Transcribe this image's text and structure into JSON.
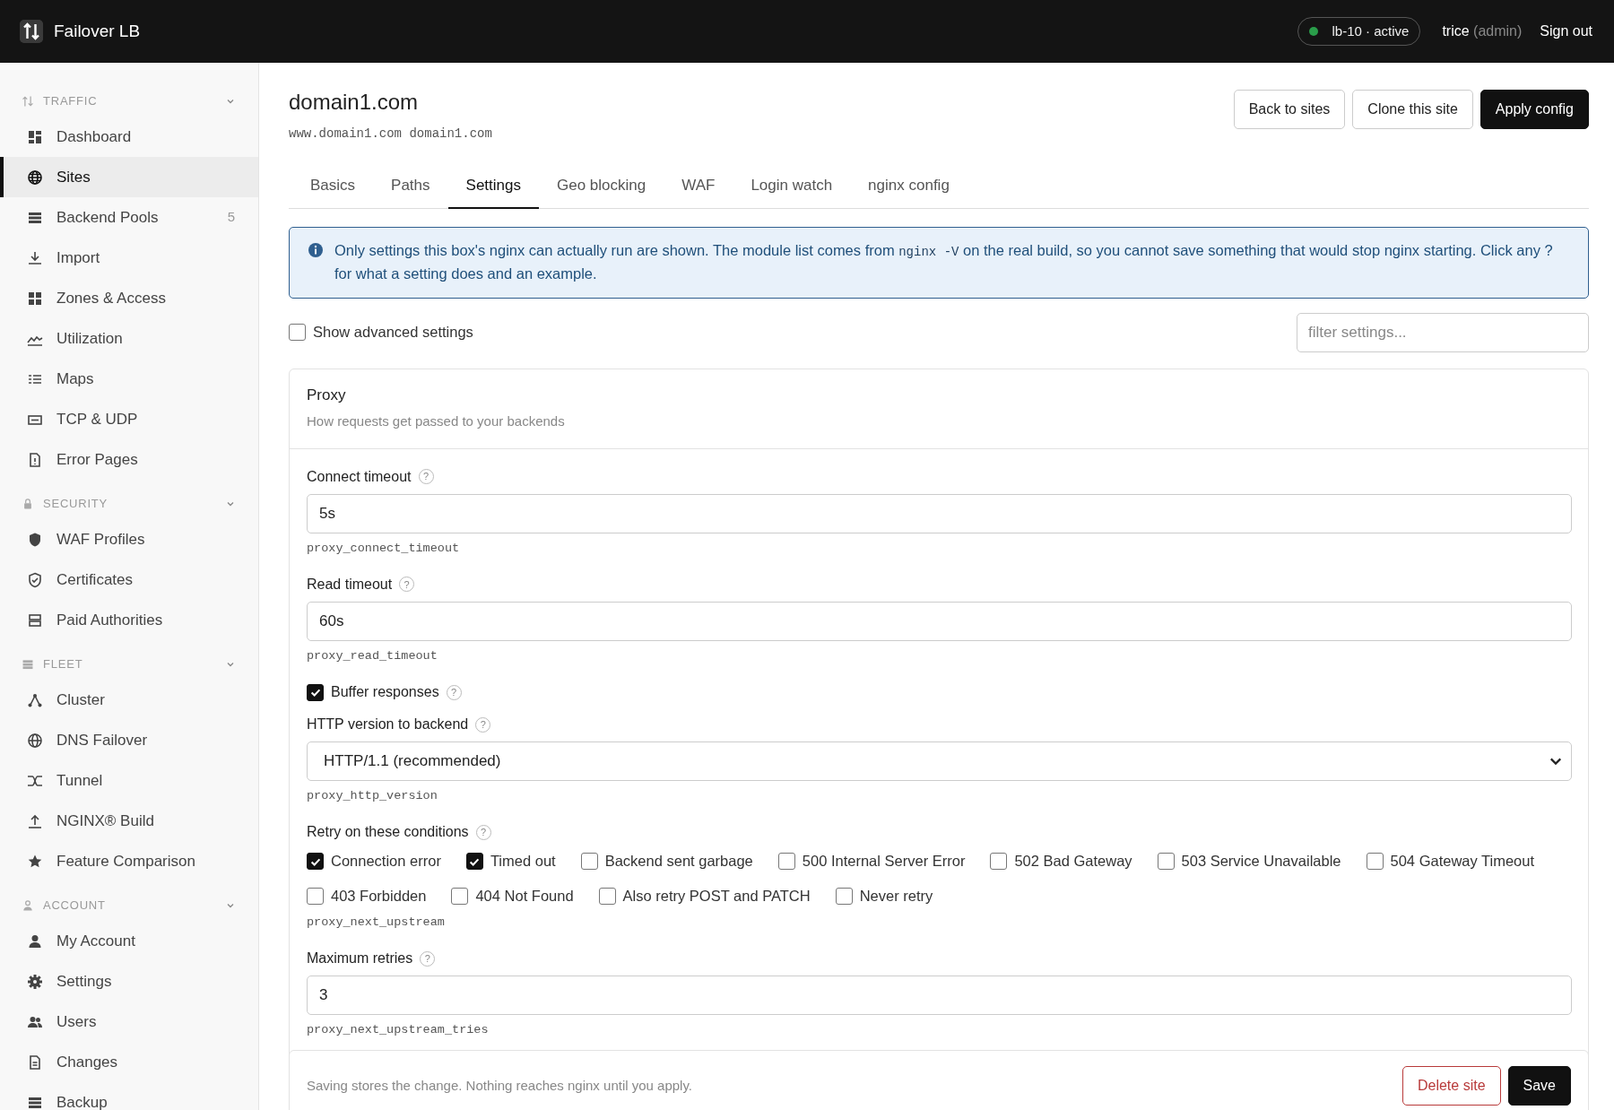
{
  "brand": {
    "name": "Failover LB"
  },
  "topbar": {
    "node": {
      "label": "lb-10 · active",
      "color": "#2a9d4a"
    },
    "user": "trice",
    "role": "(admin)",
    "sign_out": "Sign out"
  },
  "sidebar": {
    "sections": [
      {
        "title": "TRAFFIC",
        "expanded": true,
        "items": [
          {
            "label": "Dashboard",
            "selected": false
          },
          {
            "label": "Sites",
            "selected": true
          },
          {
            "label": "Backend Pools",
            "selected": false,
            "count": "5"
          },
          {
            "label": "Import",
            "selected": false
          },
          {
            "label": "Zones & Access",
            "selected": false
          },
          {
            "label": "Utilization",
            "selected": false
          },
          {
            "label": "Maps",
            "selected": false
          },
          {
            "label": "TCP & UDP",
            "selected": false
          },
          {
            "label": "Error Pages",
            "selected": false
          }
        ]
      },
      {
        "title": "SECURITY",
        "expanded": true,
        "items": [
          {
            "label": "WAF Profiles",
            "selected": false
          },
          {
            "label": "Certificates",
            "selected": false
          },
          {
            "label": "Paid Authorities",
            "selected": false
          }
        ]
      },
      {
        "title": "FLEET",
        "expanded": true,
        "items": [
          {
            "label": "Cluster",
            "selected": false
          },
          {
            "label": "DNS Failover",
            "selected": false
          },
          {
            "label": "Tunnel",
            "selected": false
          },
          {
            "label": "NGINX® Build",
            "selected": false
          },
          {
            "label": "Feature Comparison",
            "selected": false
          }
        ]
      },
      {
        "title": "ACCOUNT",
        "expanded": true,
        "items": [
          {
            "label": "My Account",
            "selected": false
          },
          {
            "label": "Settings",
            "selected": false
          },
          {
            "label": "Users",
            "selected": false
          },
          {
            "label": "Changes",
            "selected": false
          },
          {
            "label": "Backup",
            "selected": false
          }
        ]
      }
    ]
  },
  "page": {
    "title": "domain1.com",
    "aliases": "www.domain1.com domain1.com",
    "actions": [
      {
        "label": "Back to sites",
        "kind": "outline"
      },
      {
        "label": "Clone this site",
        "kind": "outline"
      },
      {
        "label": "Apply config",
        "kind": "primary"
      }
    ]
  },
  "tabs": [
    {
      "label": "Basics",
      "selected": false
    },
    {
      "label": "Paths",
      "selected": false
    },
    {
      "label": "Settings",
      "selected": true
    },
    {
      "label": "Geo blocking",
      "selected": false
    },
    {
      "label": "WAF",
      "selected": false
    },
    {
      "label": "Login watch",
      "selected": false
    },
    {
      "label": "nginx config",
      "selected": false
    }
  ],
  "notice": {
    "parts": [
      {
        "kind": "text",
        "text": "Only settings this box's nginx can actually run are shown. The module list comes from "
      },
      {
        "kind": "code",
        "text": "nginx -V"
      },
      {
        "kind": "text",
        "text": " on the real build, so you cannot save something that would stop nginx starting. Click any ? for what a setting does and an example."
      }
    ]
  },
  "show_advanced": {
    "label": "Show advanced settings",
    "checked": false
  },
  "filter": {
    "placeholder": "filter settings..."
  },
  "section": {
    "title": "Proxy",
    "subtitle": "How requests get passed to your backends",
    "settings": [
      {
        "kind": "text",
        "label": "Connect timeout",
        "help": "?",
        "value": "5s",
        "directive": "proxy_connect_timeout"
      },
      {
        "kind": "text",
        "label": "Read timeout",
        "help": "?",
        "value": "60s",
        "directive": "proxy_read_timeout"
      },
      {
        "kind": "toggle",
        "label": "Buffer responses",
        "help": "?",
        "checked": true
      },
      {
        "kind": "select",
        "label": "HTTP version to backend",
        "help": "?",
        "value": "HTTP/1.1 (recommended)",
        "directive": "proxy_http_version"
      },
      {
        "kind": "multi",
        "label": "Retry on these conditions",
        "help": "?",
        "directive": "proxy_next_upstream",
        "options": [
          {
            "label": "Connection error",
            "checked": true
          },
          {
            "label": "Timed out",
            "checked": true
          },
          {
            "label": "Backend sent garbage",
            "checked": false
          },
          {
            "label": "500 Internal Server Error",
            "checked": false
          },
          {
            "label": "502 Bad Gateway",
            "checked": false
          },
          {
            "label": "503 Service Unavailable",
            "checked": false
          },
          {
            "label": "504 Gateway Timeout",
            "checked": false
          },
          {
            "label": "403 Forbidden",
            "checked": false
          },
          {
            "label": "404 Not Found",
            "checked": false
          },
          {
            "label": "Also retry POST and PATCH",
            "checked": false
          },
          {
            "label": "Never retry",
            "checked": false
          }
        ]
      },
      {
        "kind": "text",
        "label": "Maximum retries",
        "help": "?",
        "value": "3",
        "directive": "proxy_next_upstream_tries"
      }
    ]
  },
  "footer": {
    "note": "Saving stores the change. Nothing reaches nginx until you apply.",
    "buttons": [
      {
        "label": "Delete site",
        "kind": "danger"
      },
      {
        "label": "Save",
        "kind": "primary"
      }
    ]
  }
}
